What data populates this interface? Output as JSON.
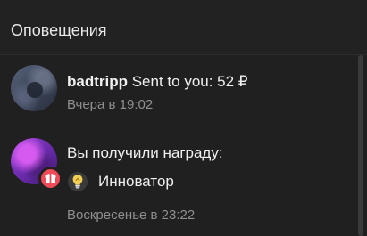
{
  "header": {
    "title": "Оповещения"
  },
  "notifications": [
    {
      "username": "badtripp",
      "message": " Sent to you: 52 ₽",
      "time": "Вчера в 19:02"
    },
    {
      "message": "Вы получили награду:",
      "award_icon": "lightbulb-icon",
      "award_name": "Инноватор",
      "badge_icon": "gift-icon",
      "time": "Воскресенье в 23:22"
    }
  ],
  "colors": {
    "background": "#202020",
    "text": "#f0f0f0",
    "muted": "#8f8f8f",
    "badge": "#ef4a57"
  }
}
